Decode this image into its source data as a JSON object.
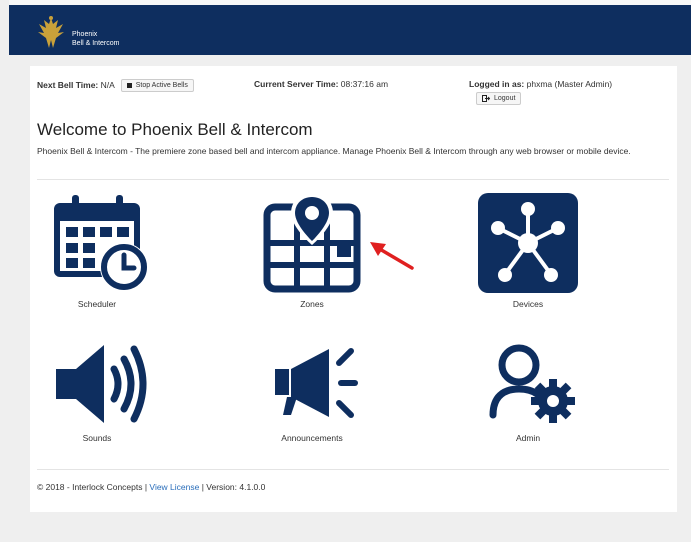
{
  "header": {
    "logo_icon": "phoenix-logo-icon",
    "brand_line1": "Phoenix",
    "brand_line2": "Bell & Intercom",
    "colors": {
      "bar": "#0e2e5f",
      "logo": "#c9a13a"
    }
  },
  "status": {
    "next_bell_label": "Next Bell Time:",
    "next_bell_value": "N/A",
    "stop_button": "Stop Active Bells",
    "server_time_label": "Current Server Time:",
    "server_time_value": "08:37:16 am",
    "logged_in_label": "Logged in as:",
    "logged_in_value": "phxma (Master Admin)",
    "logout_button": "Logout"
  },
  "main": {
    "title": "Welcome to Phoenix Bell & Intercom",
    "description": "Phoenix Bell & Intercom - The premiere zone based bell and intercom appliance. Manage Phoenix Bell & Intercom through any web browser or mobile device."
  },
  "tiles": [
    {
      "label": "Scheduler",
      "icon": "calendar-clock-icon"
    },
    {
      "label": "Zones",
      "icon": "map-pin-icon"
    },
    {
      "label": "Devices",
      "icon": "network-hub-icon"
    },
    {
      "label": "Sounds",
      "icon": "speaker-icon"
    },
    {
      "label": "Announcements",
      "icon": "megaphone-icon"
    },
    {
      "label": "Admin",
      "icon": "user-gear-icon"
    }
  ],
  "footer": {
    "copyright": "© 2018 - Interlock Concepts",
    "sep1": " | ",
    "license_link": "View License",
    "sep2": " | ",
    "version": "Version: 4.1.0.0"
  },
  "colors": {
    "icon": "#0e2e5f",
    "link": "#2a6ebb",
    "annotation_arrow": "#e02020"
  }
}
